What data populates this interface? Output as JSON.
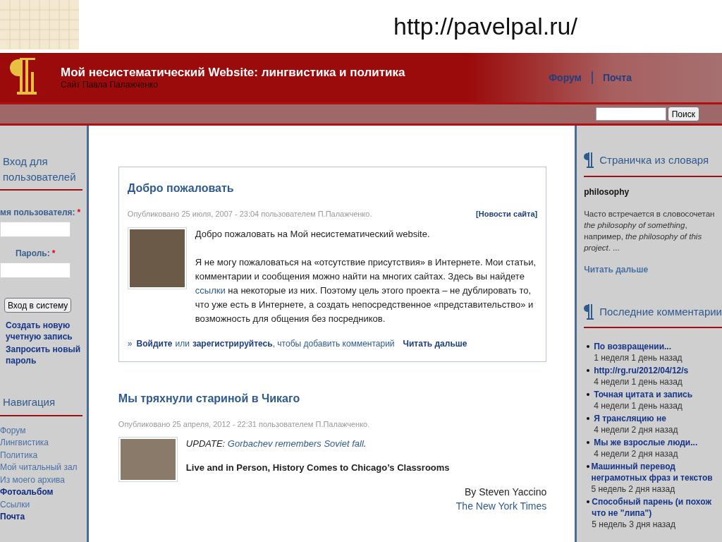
{
  "slide": {
    "url": "http://pavelpal.ru/"
  },
  "header": {
    "title": "Мой несистематический Website: лингвистика и политика",
    "subtitle": "Сайт Павла Палажченко",
    "links": [
      "Форум",
      "Почта"
    ]
  },
  "search": {
    "button": "Поиск"
  },
  "login": {
    "title": "Вход для пользователей",
    "username_label": "мя пользователя:",
    "password_label": "Пароль:",
    "required_mark": "*",
    "submit": "Вход в систему",
    "links": [
      "Создать новую учетную запись",
      "Запросить новый пароль"
    ]
  },
  "navigation": {
    "title": "Навигация",
    "items": [
      {
        "label": "Форум",
        "highlighted": false
      },
      {
        "label": "Лингвистика",
        "highlighted": false
      },
      {
        "label": "Политика",
        "highlighted": false
      },
      {
        "label": "Мой читальный зал",
        "highlighted": false
      },
      {
        "label": "Из моего архива",
        "highlighted": false
      },
      {
        "label": "Фотоальбом",
        "highlighted": true
      },
      {
        "label": "Ссылки",
        "highlighted": false
      },
      {
        "label": "Почта",
        "highlighted": true
      }
    ]
  },
  "posts": [
    {
      "title": "Добро пожаловать",
      "meta": "Опубликовано 25 июля, 2007 - 23:04 пользователем П.Палажченко.",
      "tag": "[Новости сайта]",
      "paragraphs": [
        [
          {
            "kind": "text",
            "text": "Добро пожаловать на Мой несистематический website."
          }
        ],
        [
          {
            "kind": "text",
            "text": "Я не могу пожаловаться на «отсутствие присутствия» в Интернете. Мои статьи, комментарии и сообщения можно найти на многих сайтах. Здесь вы найдете"
          },
          {
            "kind": "link",
            "text": "ссылки"
          },
          {
            "kind": "text",
            "text": "на некоторые из них. Поэтому цель этого проекта – не дублировать то, что уже есть в Интернете, а создать непосредственное «представительство» и возможность для общения без посредников."
          }
        ]
      ],
      "footer": {
        "marker": "»",
        "login": "Войдите",
        "or": "или",
        "register": "зарегистрируйтесь",
        "rest": ", чтобы добавить комментарий",
        "more": "Читать дальше"
      }
    },
    {
      "title": "Мы тряхнули стариной в Чикаго",
      "meta": "Опубликовано 25 апреля, 2012 - 22:31 пользователем П.Палажченко.",
      "paragraphs": [
        [
          {
            "kind": "italic",
            "text": "UPDATE:"
          },
          {
            "kind": "link",
            "text": "Gorbachev remembers Soviet fall"
          },
          {
            "kind": "italic",
            "text": "."
          }
        ],
        [
          {
            "kind": "bold",
            "text": "Live and in Person, History Comes to Chicago’s Classrooms"
          }
        ]
      ],
      "byline": "By Steven Yaccino",
      "source": "The New York Times"
    }
  ],
  "dictionary": {
    "title": "Страничка из словаря",
    "term": "philosophy",
    "text": "Часто встречается в словосочетан *the philosophy of something*, например, *the philosophy of this project*. ...",
    "more": "Читать дальше"
  },
  "comments": {
    "title": "Последние комментарии",
    "items": [
      {
        "title": "По возвращении...",
        "age": "1 неделя 1 день назад"
      },
      {
        "title": "http://rg.ru/2012/04/12/s",
        "age": "4 недели 1 день назад"
      },
      {
        "title": "Точная цитата и запись",
        "age": "4 недели 1 день назад"
      },
      {
        "title": "Я трансляцию не",
        "age": "4 недели 2 дня назад"
      },
      {
        "title": "Мы же взрослые люди...",
        "age": "4 недели 2 дня назад"
      },
      {
        "title": "Машинный перевод неграмотных фраз и текстов",
        "age": "5 недель 2 дня назад"
      },
      {
        "title": "Способный парень (и похож что не \"липа\")",
        "age": "5 недель 3 дня назад"
      }
    ]
  }
}
